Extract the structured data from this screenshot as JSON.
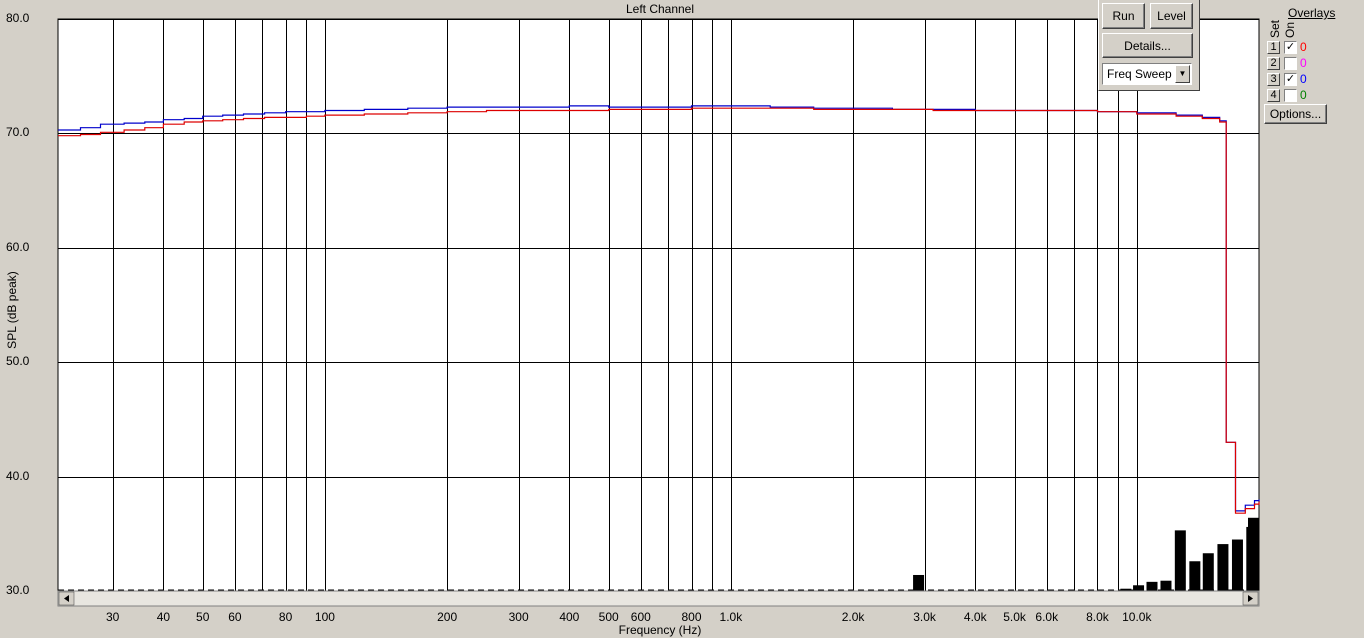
{
  "chart_data": {
    "type": "line",
    "title": "Left Channel",
    "xlabel": "Frequency (Hz)",
    "ylabel": "SPL (dB peak)",
    "x_scale": "log",
    "xlim": [
      22,
      20000
    ],
    "ylim": [
      30,
      80
    ],
    "grid": true,
    "y_ticks": [
      {
        "v": 80,
        "label": "80.0"
      },
      {
        "v": 70,
        "label": "70.0"
      },
      {
        "v": 60,
        "label": "60.0"
      },
      {
        "v": 50,
        "label": "50.0"
      },
      {
        "v": 40,
        "label": "40.0"
      },
      {
        "v": 30,
        "label": "30.0"
      }
    ],
    "x_ticks": [
      {
        "v": 30,
        "label": "30"
      },
      {
        "v": 40,
        "label": "40"
      },
      {
        "v": 50,
        "label": "50"
      },
      {
        "v": 60,
        "label": "60"
      },
      {
        "v": 80,
        "label": "80"
      },
      {
        "v": 100,
        "label": "100"
      },
      {
        "v": 200,
        "label": "200"
      },
      {
        "v": 300,
        "label": "300"
      },
      {
        "v": 400,
        "label": "400"
      },
      {
        "v": 500,
        "label": "500"
      },
      {
        "v": 600,
        "label": "600"
      },
      {
        "v": 800,
        "label": "800"
      },
      {
        "v": 1000,
        "label": "1.0k"
      },
      {
        "v": 2000,
        "label": "2.0k"
      },
      {
        "v": 3000,
        "label": "3.0k"
      },
      {
        "v": 4000,
        "label": "4.0k"
      },
      {
        "v": 5000,
        "label": "5.0k"
      },
      {
        "v": 6000,
        "label": "6.0k"
      },
      {
        "v": 8000,
        "label": "8.0k"
      },
      {
        "v": 10000,
        "label": "10.0k"
      }
    ],
    "x_gridlines": [
      30,
      40,
      50,
      60,
      70,
      80,
      90,
      100,
      200,
      300,
      400,
      500,
      600,
      700,
      800,
      900,
      1000,
      2000,
      3000,
      4000,
      5000,
      6000,
      7000,
      8000,
      9000,
      10000
    ],
    "series": [
      {
        "color": "#0000cc",
        "x": [
          22,
          25,
          28,
          32,
          36,
          40,
          45,
          50,
          56,
          63,
          71,
          80,
          90,
          100,
          125,
          160,
          200,
          250,
          315,
          400,
          500,
          630,
          800,
          1000,
          1250,
          1600,
          2000,
          2500,
          3150,
          4000,
          5000,
          6300,
          8000,
          10000,
          12500,
          14500,
          16000,
          16600,
          17500,
          18500,
          19500,
          20000
        ],
        "y": [
          70.3,
          70.5,
          70.8,
          70.9,
          71.0,
          71.2,
          71.3,
          71.5,
          71.6,
          71.7,
          71.8,
          71.9,
          71.9,
          72.0,
          72.1,
          72.2,
          72.3,
          72.3,
          72.3,
          72.4,
          72.3,
          72.3,
          72.4,
          72.4,
          72.3,
          72.2,
          72.2,
          72.1,
          72.1,
          72.0,
          72.0,
          72.0,
          71.9,
          71.8,
          71.6,
          71.4,
          71.1,
          43.0,
          37.0,
          37.5,
          37.9,
          38.0
        ]
      },
      {
        "color": "#dd0000",
        "x": [
          22,
          25,
          28,
          32,
          36,
          40,
          45,
          50,
          56,
          63,
          71,
          80,
          90,
          100,
          125,
          160,
          200,
          250,
          315,
          400,
          500,
          630,
          800,
          1000,
          1250,
          1600,
          2000,
          2500,
          3150,
          4000,
          5000,
          6300,
          8000,
          10000,
          12500,
          14500,
          16000,
          16600,
          17500,
          18500,
          19500,
          20000
        ],
        "y": [
          69.8,
          69.9,
          70.1,
          70.3,
          70.5,
          70.8,
          71.0,
          71.1,
          71.2,
          71.3,
          71.4,
          71.4,
          71.5,
          71.6,
          71.7,
          71.8,
          71.9,
          72.0,
          72.0,
          72.0,
          72.1,
          72.1,
          72.2,
          72.2,
          72.2,
          72.1,
          72.1,
          72.1,
          72.0,
          72.0,
          72.0,
          72.0,
          71.9,
          71.7,
          71.5,
          71.3,
          71.0,
          43.0,
          36.8,
          37.2,
          37.6,
          37.8
        ]
      }
    ],
    "noise_bars": [
      {
        "x": 2900,
        "y": 31.4
      },
      {
        "x": 9400,
        "y": 30.2
      },
      {
        "x": 10100,
        "y": 30.5
      },
      {
        "x": 10900,
        "y": 30.8
      },
      {
        "x": 11800,
        "y": 30.9
      },
      {
        "x": 12800,
        "y": 35.3
      },
      {
        "x": 13900,
        "y": 32.6
      },
      {
        "x": 15000,
        "y": 33.3
      },
      {
        "x": 16300,
        "y": 34.1
      },
      {
        "x": 17700,
        "y": 34.5
      },
      {
        "x": 19200,
        "y": 35.6
      },
      {
        "x": 20000,
        "y": 36.4
      }
    ]
  },
  "controls": {
    "run_label": "Run",
    "level_label": "Level",
    "details_label": "Details...",
    "mode_value": "Freq Sweep",
    "options_label": "Options..."
  },
  "overlays": {
    "title": "Overlays",
    "set_header": "Set",
    "on_header": "On",
    "rows": [
      {
        "set": "1",
        "checked": true,
        "value": "0",
        "color": "#ff0000"
      },
      {
        "set": "2",
        "checked": false,
        "value": "0",
        "color": "#ff00ff"
      },
      {
        "set": "3",
        "checked": true,
        "value": "0",
        "color": "#0000ff"
      },
      {
        "set": "4",
        "checked": false,
        "value": "0",
        "color": "#008000"
      }
    ]
  },
  "icons": {
    "scroll_left": "scroll-left-arrow-icon",
    "scroll_right": "scroll-right-arrow-icon",
    "dropdown": "chevron-down-icon",
    "check": "checkmark-icon"
  }
}
